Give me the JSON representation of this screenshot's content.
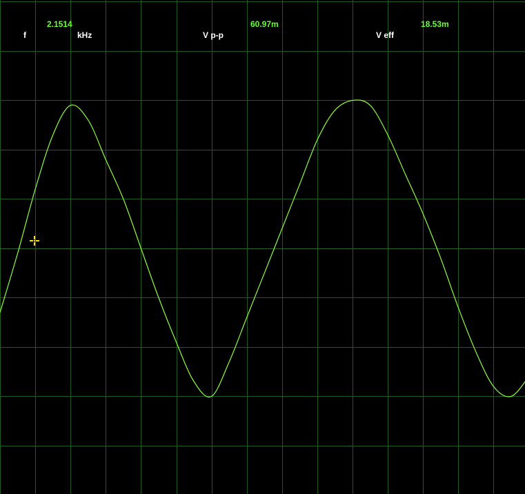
{
  "measurements": {
    "frequency": {
      "label": "f",
      "value": "2.1514",
      "unit": "kHz"
    },
    "vpp": {
      "label": "V p-p",
      "value": "60.97m"
    },
    "veff": {
      "label": "V eff",
      "value": "18.53m"
    }
  },
  "colors": {
    "background": "#000000",
    "grid": "#1f5a1f",
    "trace": "#8cff3c",
    "value_text": "#66ff33",
    "label_text": "#ffffff",
    "trigger_marker": "#ffe400",
    "zero_line": "#3a6a3a"
  },
  "icons": {
    "trigger_marker": "trigger-crosshair-icon"
  },
  "chart_data": {
    "type": "line",
    "waveform": "sine",
    "grid": true,
    "divisions": {
      "horizontal": 15,
      "vertical": 10
    },
    "series": [
      {
        "x": [
          0,
          0.5,
          1,
          1.5,
          2,
          2.5,
          3,
          3.5,
          4,
          4.5,
          5,
          5.5,
          6,
          6.5,
          7,
          7.5,
          8,
          8.5,
          9,
          9.5,
          10,
          10.5,
          11,
          11.5,
          12,
          12.5,
          13,
          13.5,
          14,
          14.5,
          15
        ],
        "y": [
          -1.3,
          -0.1,
          1.2,
          2.3,
          2.9,
          2.6,
          1.8,
          1.0,
          0.0,
          -1.0,
          -1.9,
          -2.7,
          -3.0,
          -2.3,
          -1.4,
          -0.5,
          0.4,
          1.3,
          2.2,
          2.8,
          3.0,
          2.9,
          2.3,
          1.5,
          0.7,
          -0.2,
          -1.2,
          -2.1,
          -2.8,
          -3.0,
          -2.6
        ]
      }
    ]
  }
}
